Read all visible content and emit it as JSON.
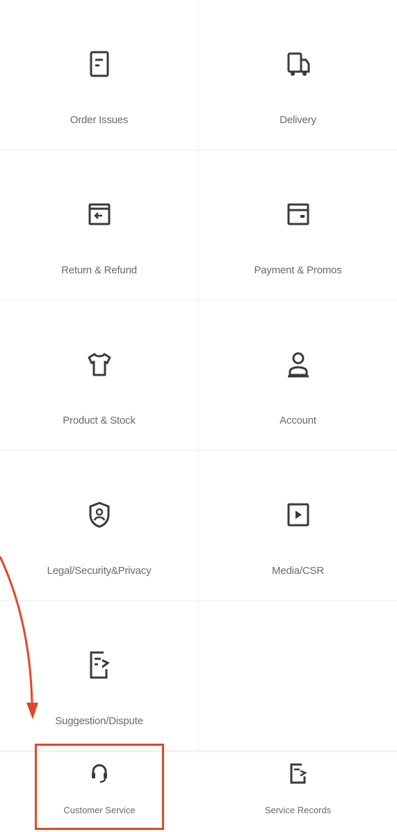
{
  "categories": [
    {
      "label": "Order Issues",
      "icon": "order-document-icon"
    },
    {
      "label": "Delivery",
      "icon": "delivery-truck-icon"
    },
    {
      "label": "Return & Refund",
      "icon": "return-box-icon"
    },
    {
      "label": "Payment & Promos",
      "icon": "wallet-card-icon"
    },
    {
      "label": "Product & Stock",
      "icon": "shirt-icon"
    },
    {
      "label": "Account",
      "icon": "user-icon"
    },
    {
      "label": "Legal/Security&Privacy",
      "icon": "shield-user-icon"
    },
    {
      "label": "Media/CSR",
      "icon": "media-play-icon"
    },
    {
      "label": "Suggestion/Dispute",
      "icon": "feedback-document-icon"
    }
  ],
  "bottom_bar": {
    "customer_service": {
      "label": "Customer Service",
      "icon": "headset-icon"
    },
    "service_records": {
      "label": "Service Records",
      "icon": "records-document-icon"
    }
  },
  "annotation": {
    "highlight_color": "#e2462a",
    "highlighted_item": "Customer Service"
  },
  "colors": {
    "icon_stroke": "#3a3a3a",
    "label_text": "#6a6a6a",
    "grid_line": "#f0f0f0",
    "background": "#ffffff"
  }
}
